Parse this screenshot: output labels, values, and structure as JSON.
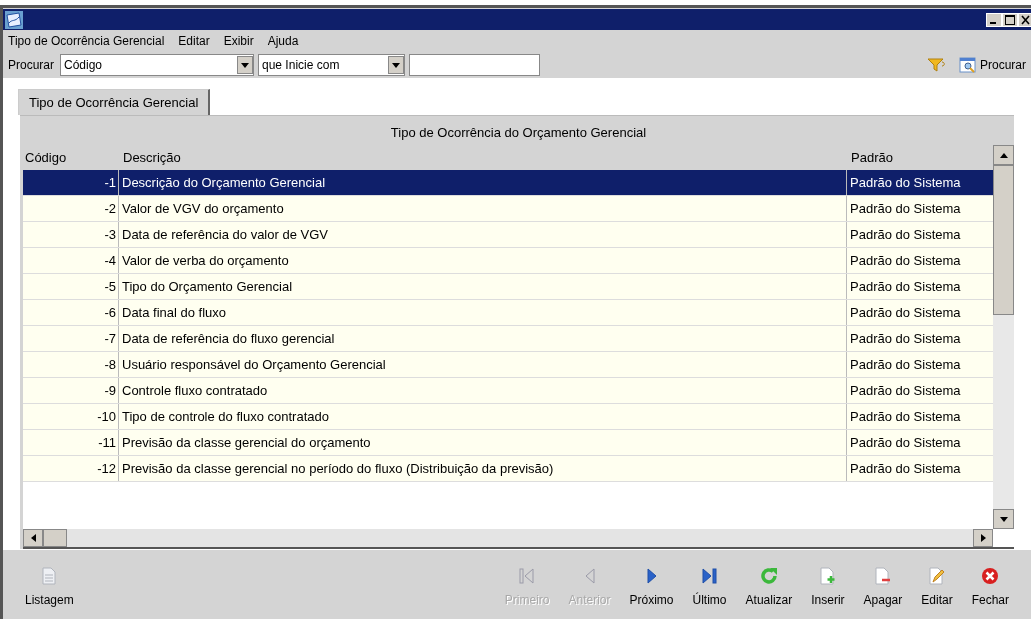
{
  "menu": [
    {
      "label": "Tipo de Ocorrência Gerencial"
    },
    {
      "label": "Editar"
    },
    {
      "label": "Exibir"
    },
    {
      "label": "Ajuda"
    }
  ],
  "search": {
    "label": "Procurar",
    "field": "Código",
    "condition": "que Inicie com",
    "button": "Procurar"
  },
  "tabs": [
    {
      "label": "Tipo de Ocorrência Gerencial",
      "selected": true
    }
  ],
  "table": {
    "group_header": "Tipo de Ocorrência do Orçamento Gerencial",
    "columns": [
      "Código",
      "Descrição",
      "Padrão"
    ],
    "rows": [
      {
        "code": "-1",
        "description": "Descrição do Orçamento Gerencial",
        "default": "Padrão do Sistema",
        "selected": true
      },
      {
        "code": "-2",
        "description": "Valor de VGV do orçamento",
        "default": "Padrão do Sistema",
        "selected": false
      },
      {
        "code": "-3",
        "description": "Data de referência do valor de VGV",
        "default": "Padrão do Sistema",
        "selected": false
      },
      {
        "code": "-4",
        "description": "Valor de verba do orçamento",
        "default": "Padrão do Sistema",
        "selected": false
      },
      {
        "code": "-5",
        "description": "Tipo do Orçamento Gerencial",
        "default": "Padrão do Sistema",
        "selected": false
      },
      {
        "code": "-6",
        "description": "Data final do fluxo",
        "default": "Padrão do Sistema",
        "selected": false
      },
      {
        "code": "-7",
        "description": "Data de referência do fluxo gerencial",
        "default": "Padrão do Sistema",
        "selected": false
      },
      {
        "code": "-8",
        "description": "Usuário responsável do Orçamento Gerencial",
        "default": "Padrão do Sistema",
        "selected": false
      },
      {
        "code": "-9",
        "description": "Controle fluxo contratado",
        "default": "Padrão do Sistema",
        "selected": false
      },
      {
        "code": "-10",
        "description": "Tipo de controle do fluxo contratado",
        "default": "Padrão do Sistema",
        "selected": false
      },
      {
        "code": "-11",
        "description": "Previsão da classe gerencial do orçamento",
        "default": "Padrão do Sistema",
        "selected": false
      },
      {
        "code": "-12",
        "description": "Previsão da classe gerencial no período do fluxo (Distribuição da previsão)",
        "default": "Padrão do Sistema",
        "selected": false
      }
    ]
  },
  "toolbar": [
    {
      "kind": "list",
      "label": "Listagem",
      "disabled": false
    },
    {
      "kind": "first",
      "label": "Primeiro",
      "disabled": true
    },
    {
      "kind": "previous",
      "label": "Anterior",
      "disabled": true
    },
    {
      "kind": "next",
      "label": "Próximo",
      "disabled": false
    },
    {
      "kind": "last",
      "label": "Último",
      "disabled": false
    },
    {
      "kind": "refresh",
      "label": "Atualizar",
      "disabled": false
    },
    {
      "kind": "insert",
      "label": "Inserir",
      "disabled": false
    },
    {
      "kind": "delete",
      "label": "Apagar",
      "disabled": false
    },
    {
      "kind": "edit",
      "label": "Editar",
      "disabled": false
    },
    {
      "kind": "close",
      "label": "Fechar",
      "disabled": false
    }
  ]
}
